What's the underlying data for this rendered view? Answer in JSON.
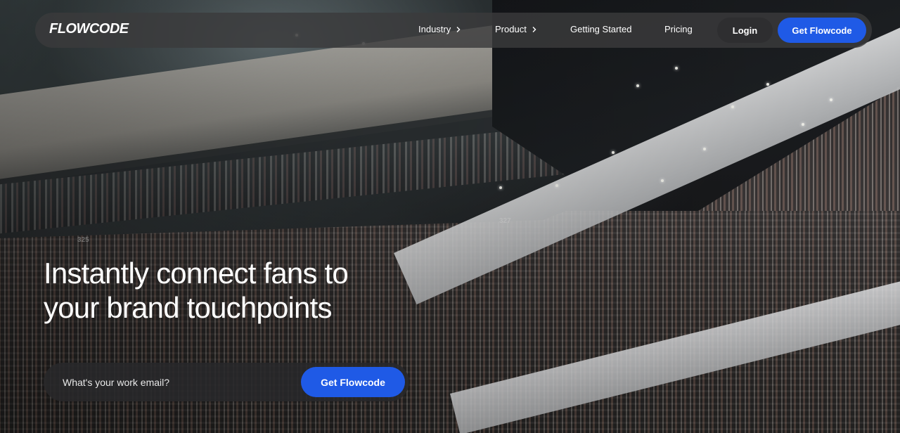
{
  "nav": {
    "logo": "FLOWCODE",
    "items": [
      {
        "label": "Industry",
        "has_dropdown": true
      },
      {
        "label": "Product",
        "has_dropdown": true
      },
      {
        "label": "Getting Started",
        "has_dropdown": false
      },
      {
        "label": "Pricing",
        "has_dropdown": false
      }
    ],
    "login_label": "Login",
    "cta_label": "Get Flowcode"
  },
  "hero": {
    "headline_line1": "Instantly connect fans to",
    "headline_line2": "your brand touchpoints",
    "email_placeholder": "What's your work email?",
    "cta_label": "Get Flowcode",
    "section_labels": [
      "325",
      "327"
    ]
  },
  "colors": {
    "accent": "#1f5ae6",
    "nav_bg": "#3a3a3c",
    "text": "#ffffff"
  },
  "icons": {
    "dropdown": "chevron-right-icon"
  }
}
